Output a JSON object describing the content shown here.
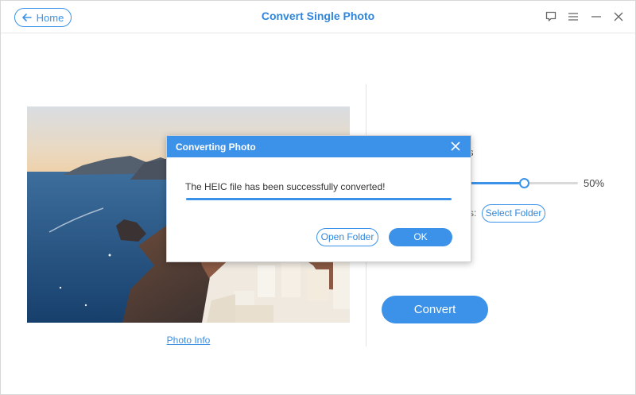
{
  "header": {
    "home_label": "Home",
    "title": "Convert Single Photo"
  },
  "window_controls": [
    "feedback-icon",
    "menu-icon",
    "minimize-icon",
    "close-icon"
  ],
  "photo": {
    "info_link": "Photo Info"
  },
  "settings": {
    "quality_partial_label": "s",
    "quality_value": "50%",
    "quality_level": 0.5,
    "output_partial_label": "s:",
    "select_folder_label": "Select Folder"
  },
  "convert_label": "Convert",
  "dialog": {
    "title": "Converting Photo",
    "message": "The HEIC file has been successfully converted!",
    "progress": 1.0,
    "open_folder_label": "Open Folder",
    "ok_label": "OK"
  },
  "colors": {
    "accent": "#3c92e8",
    "title": "#2f86dc"
  }
}
